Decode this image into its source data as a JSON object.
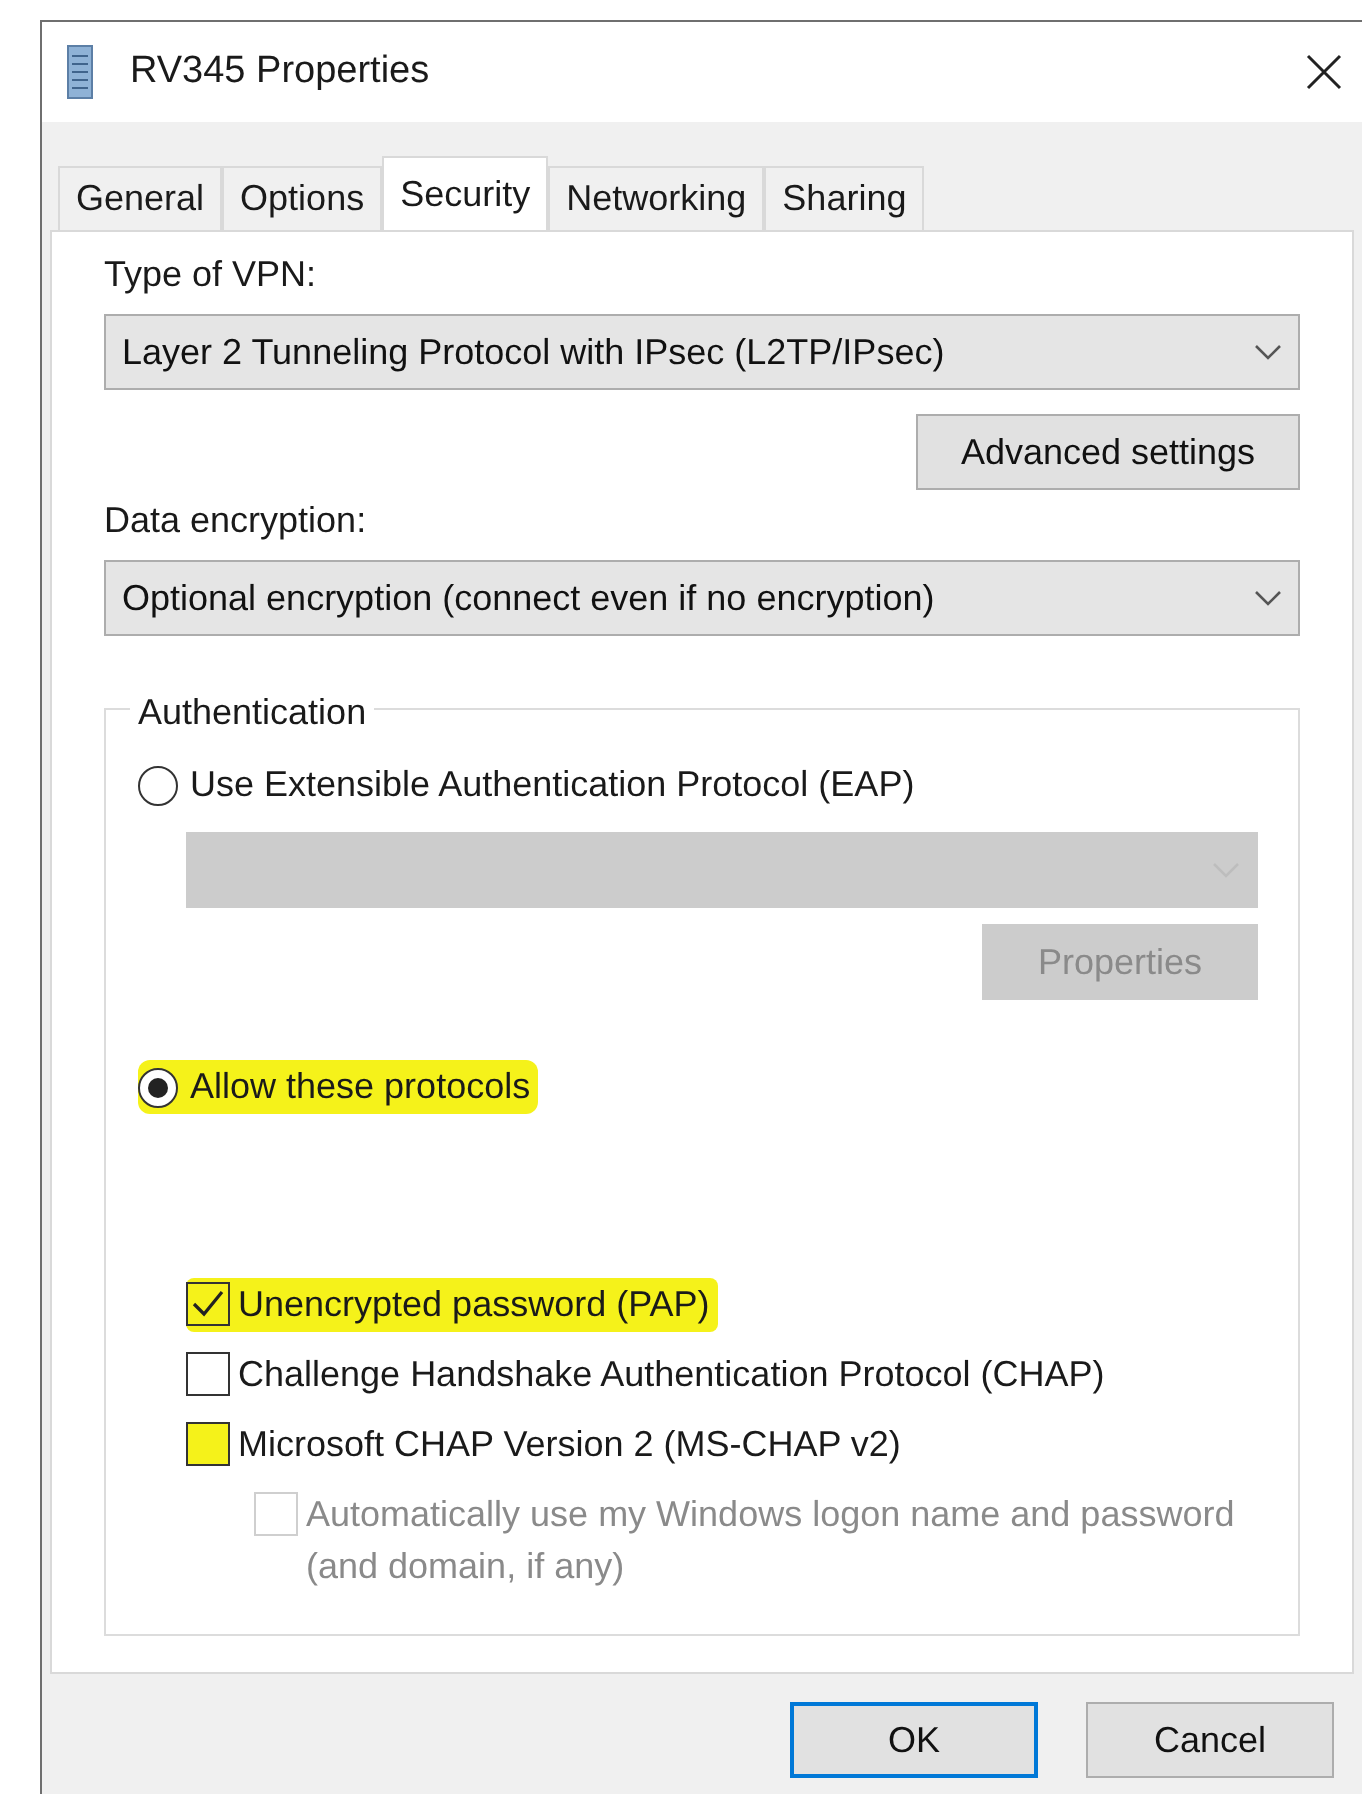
{
  "window": {
    "title": "RV345 Properties"
  },
  "tabs": [
    {
      "label": "General",
      "selected": false
    },
    {
      "label": "Options",
      "selected": false
    },
    {
      "label": "Security",
      "selected": true
    },
    {
      "label": "Networking",
      "selected": false
    },
    {
      "label": "Sharing",
      "selected": false
    }
  ],
  "vpn_type": {
    "label": "Type of VPN:",
    "value": "Layer 2 Tunneling Protocol with IPsec (L2TP/IPsec)"
  },
  "advanced_button": "Advanced settings",
  "encryption": {
    "label": "Data encryption:",
    "value": "Optional encryption (connect even if no encryption)"
  },
  "authentication": {
    "legend": "Authentication",
    "eap_radio": {
      "label": "Use Extensible Authentication Protocol (EAP)",
      "selected": false,
      "highlighted": false
    },
    "eap_select": {
      "disabled": true
    },
    "properties_button": {
      "label": "Properties",
      "disabled": true
    },
    "protocols_radio": {
      "label": "Allow these protocols",
      "selected": true,
      "highlighted": true
    },
    "protocols": [
      {
        "label": "Unencrypted password (PAP)",
        "checked": true,
        "highlighted": true
      },
      {
        "label": "Challenge Handshake Authentication Protocol (CHAP)",
        "checked": false,
        "highlighted": false
      },
      {
        "label": "Microsoft CHAP Version 2 (MS-CHAP v2)",
        "checked": false,
        "highlighted": true
      }
    ],
    "auto_logon": {
      "label": "Automatically use my Windows logon name and password (and domain, if any)",
      "checked": false,
      "disabled": true
    }
  },
  "buttons": [
    {
      "label": "OK",
      "default": true
    },
    {
      "label": "Cancel",
      "default": false
    }
  ]
}
